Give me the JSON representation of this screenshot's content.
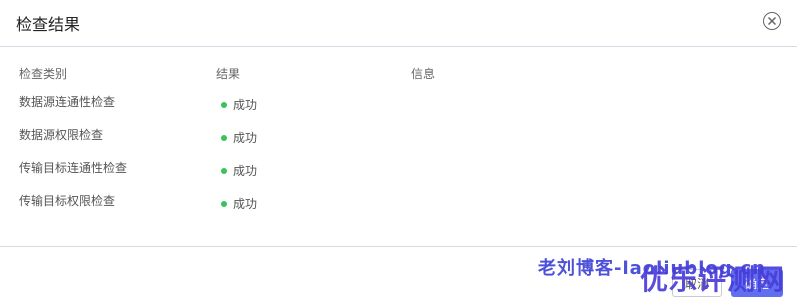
{
  "dialog": {
    "title": "检查结果",
    "close_icon": "close-circle-icon"
  },
  "table": {
    "headers": {
      "type": "检查类别",
      "result": "结果",
      "info": "信息"
    },
    "rows": [
      {
        "type": "数据源连通性检查",
        "result": "成功",
        "info": ""
      },
      {
        "type": "数据源权限检查",
        "result": "成功",
        "info": ""
      },
      {
        "type": "传输目标连通性检查",
        "result": "成功",
        "info": ""
      },
      {
        "type": "传输目标权限检查",
        "result": "成功",
        "info": ""
      }
    ],
    "status_color": "#39c45a"
  },
  "footer": {
    "cancel_label": "取消",
    "ok_label": "确定"
  },
  "watermarks": {
    "text_1": "老刘博客-laoliublog.cn",
    "text_2": "优乐评测网"
  }
}
